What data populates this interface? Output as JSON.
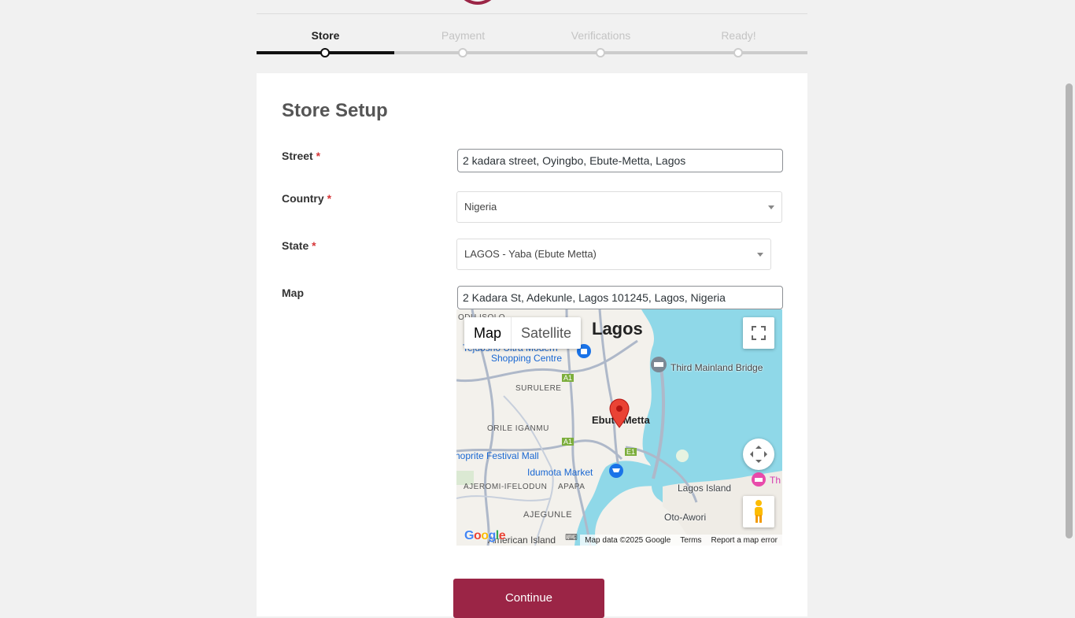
{
  "stepper": {
    "steps": [
      {
        "label": "Store",
        "active": true
      },
      {
        "label": "Payment",
        "active": false
      },
      {
        "label": "Verifications",
        "active": false
      },
      {
        "label": "Ready!",
        "active": false
      }
    ]
  },
  "form": {
    "title": "Store Setup",
    "required_mark": "*",
    "street": {
      "label": "Street",
      "value": "2 kadara street, Oyingbo, Ebute-Metta, Lagos"
    },
    "country": {
      "label": "Country",
      "value": "Nigeria"
    },
    "state": {
      "label": "State",
      "value": "LAGOS - Yaba (Ebute Metta)"
    },
    "map": {
      "label": "Map",
      "search_value": "2 Kadara St, Adekunle, Lagos 101245, Lagos, Nigeria",
      "type_map": "Map",
      "type_satellite": "Satellite",
      "places": {
        "lagos": "Lagos",
        "shopping1": "Tejuosho Ultra Modern",
        "shopping2": "Shopping Centre",
        "bridge": "Third Mainland Bridge",
        "surulere": "SURULERE",
        "ebute": "Ebute Metta",
        "orile": "ORILE IGANMU",
        "festival": "Shoprite Festival Mall",
        "idumota": "Idumota Market",
        "ajeromi": "AJEROMI-IFELODUN",
        "apapa": "APAPA",
        "ajegunle": "AJEGUNLE",
        "lagos_island": "Lagos Island",
        "oto_awori": "Oto-Awori",
        "american": "American Island",
        "oduisolo": "ODU ISOLO",
        "th": "Th",
        "a1a": "A1",
        "a1b": "A1",
        "e1": "E1"
      },
      "google": "Google",
      "attribution": "Map data ©2025 Google",
      "terms": "Terms",
      "report": "Report a map error"
    },
    "continue_label": "Continue"
  },
  "colors": {
    "brand": "#9b2546",
    "water": "#8fd8e8"
  }
}
